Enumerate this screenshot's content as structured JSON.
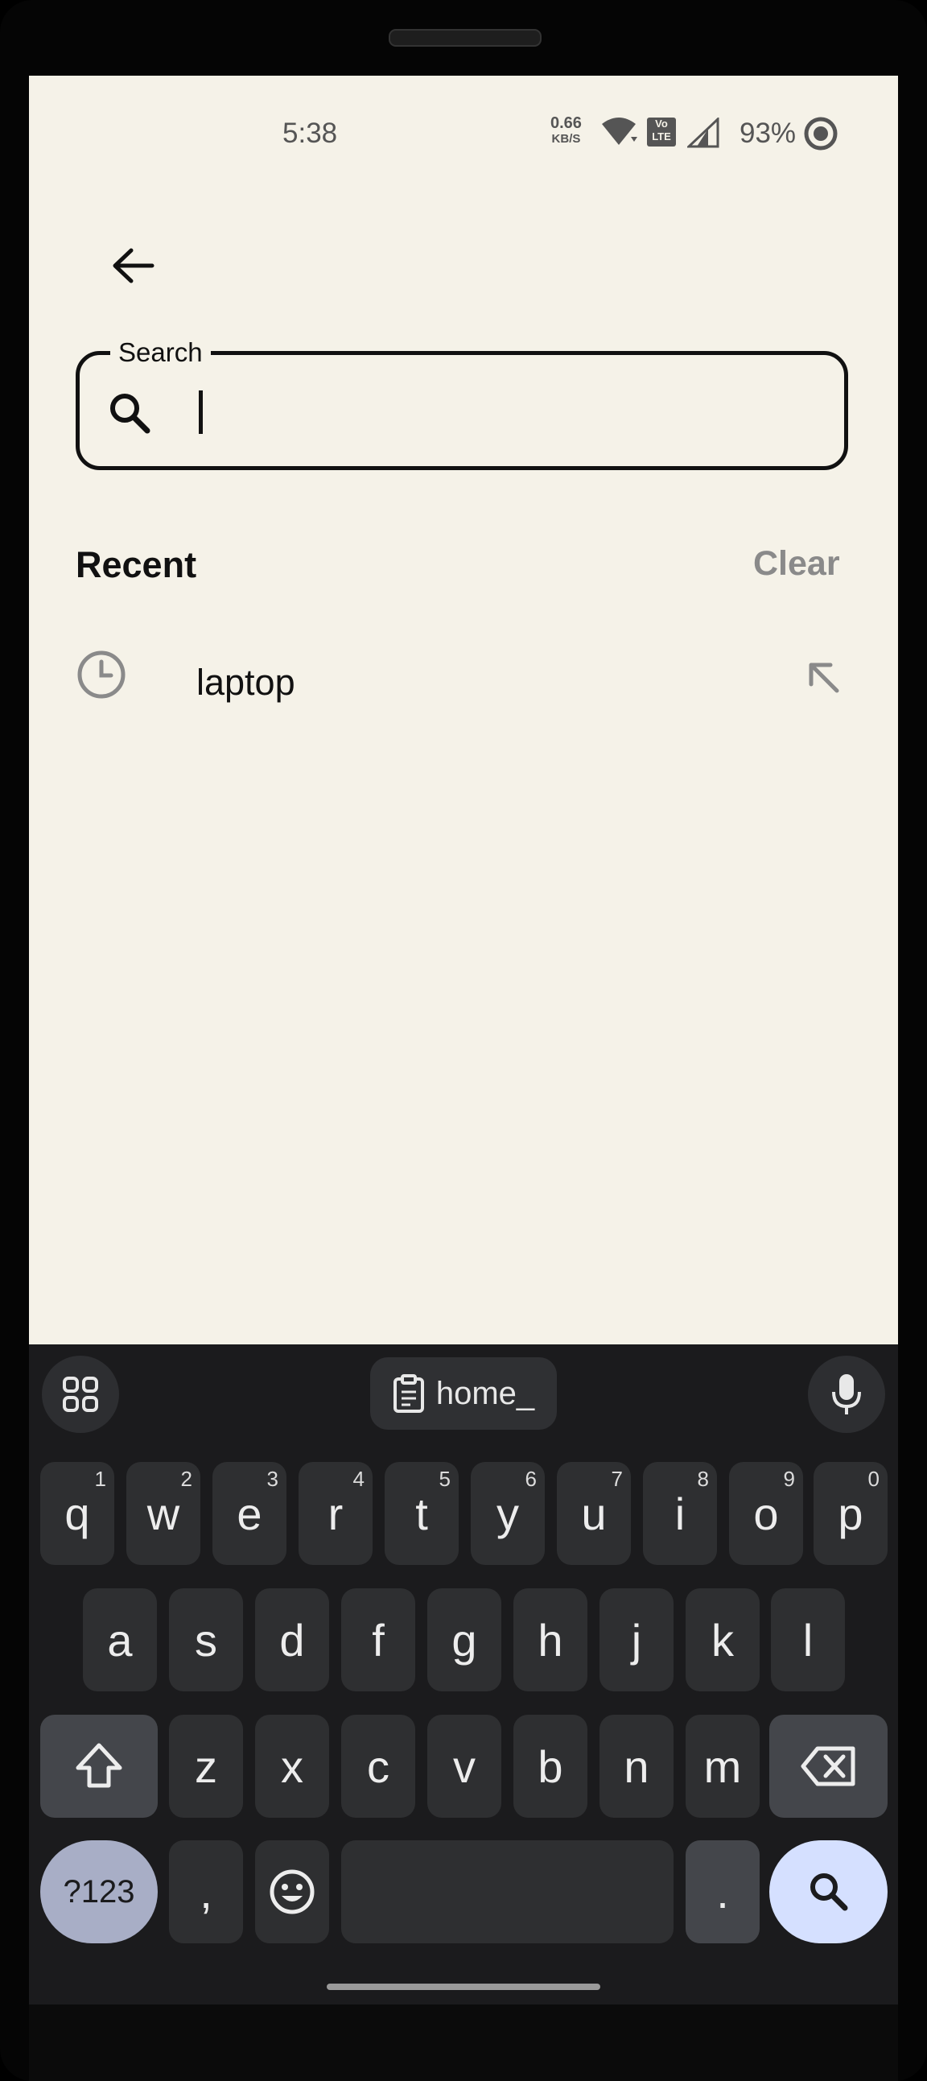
{
  "status_bar": {
    "time": "5:38",
    "net_speed_value": "0.66",
    "net_speed_unit": "KB/S",
    "volte_label": "Vo LTE",
    "battery_percent": "93%"
  },
  "search": {
    "label": "Search",
    "value": ""
  },
  "recent": {
    "title": "Recent",
    "clear_label": "Clear",
    "items": [
      {
        "text": "laptop",
        "icon": "clock-icon",
        "action_icon": "arrow-up-left-icon"
      }
    ]
  },
  "keyboard": {
    "clipboard_suggestion": "home_",
    "row1": [
      {
        "key": "q",
        "hint": "1"
      },
      {
        "key": "w",
        "hint": "2"
      },
      {
        "key": "e",
        "hint": "3"
      },
      {
        "key": "r",
        "hint": "4"
      },
      {
        "key": "t",
        "hint": "5"
      },
      {
        "key": "y",
        "hint": "6"
      },
      {
        "key": "u",
        "hint": "7"
      },
      {
        "key": "i",
        "hint": "8"
      },
      {
        "key": "o",
        "hint": "9"
      },
      {
        "key": "p",
        "hint": "0"
      }
    ],
    "row2": [
      "a",
      "s",
      "d",
      "f",
      "g",
      "h",
      "j",
      "k",
      "l"
    ],
    "row3": [
      "z",
      "x",
      "c",
      "v",
      "b",
      "n",
      "m"
    ],
    "symbols_label": "?123",
    "comma": ",",
    "period": "."
  },
  "colors": {
    "screen_bg": "#f5f2e8",
    "keyboard_bg": "#1b1b1d",
    "key_bg": "#2e2f31",
    "action_key_bg": "#d5e0ff",
    "symbol_key_bg": "#a8aec6"
  }
}
